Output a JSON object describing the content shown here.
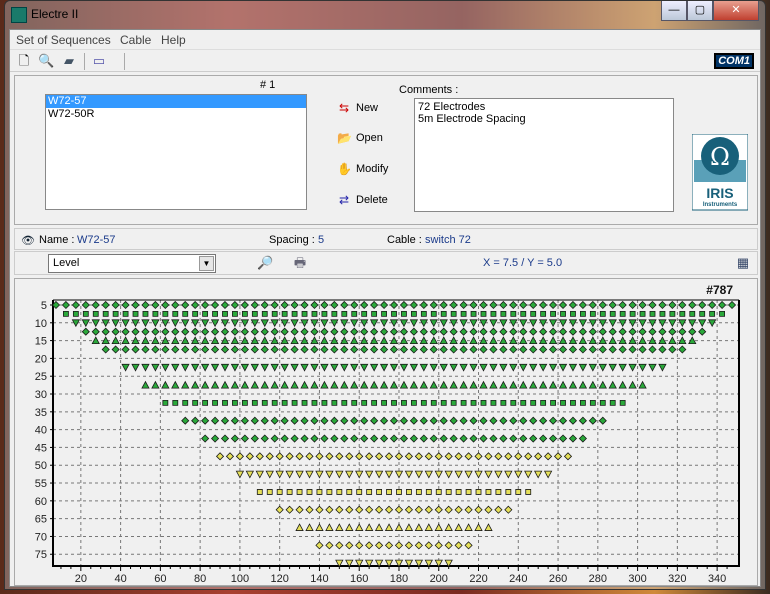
{
  "window": {
    "title": "Electre II",
    "min": "—",
    "max": "▢",
    "close": "✕"
  },
  "menu": [
    "Set of Sequences",
    "Cable",
    "Help"
  ],
  "toolbar": {
    "icons": [
      "new-file-icon",
      "open-search-icon",
      "save-device-icon",
      "transfer-icon"
    ],
    "com_label": "COM1"
  },
  "sequences": {
    "header": "# 1",
    "items": [
      {
        "label": "W72-57",
        "selected": true
      },
      {
        "label": "W72-50R",
        "selected": false
      }
    ]
  },
  "actions": [
    {
      "label": "New",
      "icon": "new-icon"
    },
    {
      "label": "Open",
      "icon": "open-icon"
    },
    {
      "label": "Modify",
      "icon": "modify-icon"
    },
    {
      "label": "Delete",
      "icon": "delete-icon"
    }
  ],
  "comments": {
    "label": "Comments :",
    "lines": [
      "72 Electrodes",
      "5m Electrode Spacing"
    ]
  },
  "logo": {
    "text": "IRIS",
    "sub": "Instruments"
  },
  "info": {
    "name_label": "Name :",
    "name": "W72-57",
    "spacing_label": "Spacing :",
    "spacing": "5",
    "cable_label": "Cable :",
    "cable": "switch 72"
  },
  "view": {
    "select": "Level",
    "coords": "X = 7.5  /  Y = 5.0"
  },
  "chart_data": {
    "type": "scatter",
    "annotation": "#787",
    "xlim": [
      6,
      351
    ],
    "ylim": [
      3.6,
      78.3
    ],
    "y_inverted": true,
    "grid": true,
    "xticks": [
      20,
      40,
      60,
      80,
      100,
      120,
      140,
      160,
      180,
      200,
      220,
      240,
      260,
      280,
      300,
      320,
      340
    ],
    "yticks": [
      5,
      10,
      15,
      20,
      25,
      30,
      35,
      40,
      45,
      50,
      55,
      60,
      65,
      70,
      75
    ],
    "colors": {
      "green": "#2aa83a",
      "yellow": "#e6e05a"
    },
    "rows": [
      {
        "y": 5,
        "x_start": 7.5,
        "x_end": 347.5,
        "step": 5,
        "shape": "diamond",
        "color": "green"
      },
      {
        "y": 7.5,
        "x_start": 12.5,
        "x_end": 342.5,
        "step": 5,
        "shape": "square",
        "color": "green"
      },
      {
        "y": 10,
        "x_start": 17.5,
        "x_end": 337.5,
        "step": 5,
        "shape": "triangle-down",
        "color": "green"
      },
      {
        "y": 12.5,
        "x_start": 22.5,
        "x_end": 332.5,
        "step": 5,
        "shape": "diamond",
        "color": "green"
      },
      {
        "y": 15,
        "x_start": 27.5,
        "x_end": 327.5,
        "step": 5,
        "shape": "triangle-up",
        "color": "green"
      },
      {
        "y": 17.5,
        "x_start": 32.5,
        "x_end": 322.5,
        "step": 5,
        "shape": "diamond",
        "color": "green"
      },
      {
        "y": 22.5,
        "x_start": 42.5,
        "x_end": 312.5,
        "step": 5,
        "shape": "triangle-down",
        "color": "green"
      },
      {
        "y": 27.5,
        "x_start": 52.5,
        "x_end": 302.5,
        "step": 5,
        "shape": "triangle-up",
        "color": "green"
      },
      {
        "y": 32.5,
        "x_start": 62.5,
        "x_end": 292.5,
        "step": 5,
        "shape": "square",
        "color": "green"
      },
      {
        "y": 37.5,
        "x_start": 72.5,
        "x_end": 282.5,
        "step": 5,
        "shape": "diamond",
        "color": "green"
      },
      {
        "y": 42.5,
        "x_start": 82.5,
        "x_end": 272.5,
        "step": 5,
        "shape": "diamond",
        "color": "green"
      },
      {
        "y": 47.5,
        "x_start": 90,
        "x_end": 265,
        "step": 5,
        "shape": "diamond",
        "color": "yellow"
      },
      {
        "y": 52.5,
        "x_start": 100,
        "x_end": 255,
        "step": 5,
        "shape": "triangle-down",
        "color": "yellow"
      },
      {
        "y": 57.5,
        "x_start": 110,
        "x_end": 245,
        "step": 5,
        "shape": "square",
        "color": "yellow"
      },
      {
        "y": 62.5,
        "x_start": 120,
        "x_end": 235,
        "step": 5,
        "shape": "diamond",
        "color": "yellow"
      },
      {
        "y": 67.5,
        "x_start": 130,
        "x_end": 225,
        "step": 5,
        "shape": "triangle-up",
        "color": "yellow"
      },
      {
        "y": 72.5,
        "x_start": 140,
        "x_end": 215,
        "step": 5,
        "shape": "diamond",
        "color": "yellow"
      },
      {
        "y": 77.5,
        "x_start": 150,
        "x_end": 205,
        "step": 5,
        "shape": "triangle-down",
        "color": "yellow"
      }
    ]
  }
}
